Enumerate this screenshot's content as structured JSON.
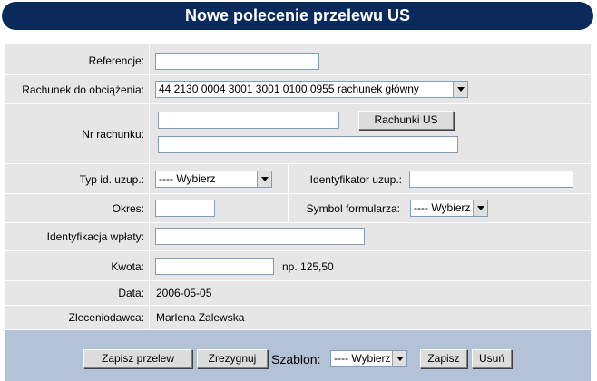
{
  "title": "Nowe polecenie przelewu US",
  "form": {
    "referencje": {
      "label": "Referencje:",
      "value": ""
    },
    "rachunek": {
      "label": "Rachunek do obciążenia:",
      "selected": "44 2130 0004 3001 3001 0100 0955 rachunek główny"
    },
    "nr_rachunku": {
      "label": "Nr rachunku:",
      "value1": "",
      "value2": "",
      "button": "Rachunki US"
    },
    "typ_id": {
      "label": "Typ id. uzup.:",
      "selected": "---- Wybierz"
    },
    "identyfikator": {
      "label": "Identyfikator uzup.:",
      "value": ""
    },
    "okres": {
      "label": "Okres:",
      "value": ""
    },
    "symbol": {
      "label": "Symbol formularza:",
      "selected": "---- Wybierz"
    },
    "identyfikacja": {
      "label": "Identyfikacja wpłaty:",
      "value": ""
    },
    "kwota": {
      "label": "Kwota:",
      "value": "",
      "hint": "np. 125,50"
    },
    "data": {
      "label": "Data:",
      "value": "2006-05-05"
    },
    "zleceniodawca": {
      "label": "Zleceniodawca:",
      "value": "Marlena Zalewska"
    }
  },
  "actions": {
    "zapisz_przelew": "Zapisz przelew",
    "zrezygnuj": "Zrezygnuj",
    "szablon_label": "Szablon:",
    "szablon_selected": "---- Wybierz",
    "zapisz": "Zapisz",
    "usun": "Usuń"
  }
}
